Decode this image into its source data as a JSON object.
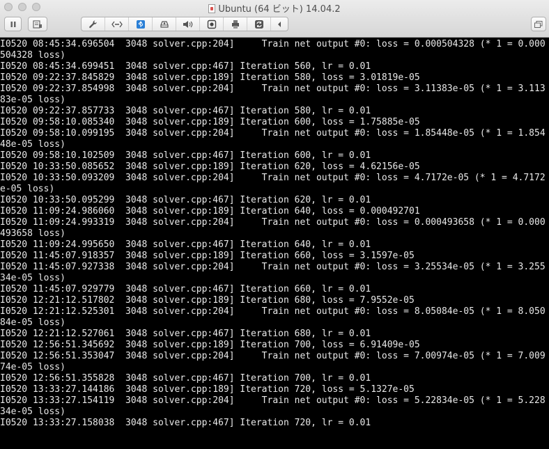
{
  "window": {
    "title": "Ubuntu (64 ビット) 14.04.2"
  },
  "toolbar": {
    "icons": [
      "pause-icon",
      "snapshot-icon",
      "wrench-icon",
      "network-icon",
      "usb-icon",
      "disk-icon",
      "speaker-icon",
      "camera-icon",
      "printer-icon",
      "sync-icon",
      "chevron-left-icon",
      "window-icon"
    ]
  },
  "terminal": {
    "lines": [
      "I0520 08:45:34.696504  3048 solver.cpp:204]     Train net output #0: loss = 0.000504328 (* 1 = 0.000",
      "504328 loss)",
      "I0520 08:45:34.699451  3048 solver.cpp:467] Iteration 560, lr = 0.01",
      "I0520 09:22:37.845829  3048 solver.cpp:189] Iteration 580, loss = 3.01819e-05",
      "I0520 09:22:37.854998  3048 solver.cpp:204]     Train net output #0: loss = 3.11383e-05 (* 1 = 3.113",
      "83e-05 loss)",
      "I0520 09:22:37.857733  3048 solver.cpp:467] Iteration 580, lr = 0.01",
      "I0520 09:58:10.085340  3048 solver.cpp:189] Iteration 600, loss = 1.75885e-05",
      "I0520 09:58:10.099195  3048 solver.cpp:204]     Train net output #0: loss = 1.85448e-05 (* 1 = 1.854",
      "48e-05 loss)",
      "I0520 09:58:10.102509  3048 solver.cpp:467] Iteration 600, lr = 0.01",
      "I0520 10:33:50.085652  3048 solver.cpp:189] Iteration 620, loss = 4.62156e-05",
      "I0520 10:33:50.093209  3048 solver.cpp:204]     Train net output #0: loss = 4.7172e-05 (* 1 = 4.7172",
      "e-05 loss)",
      "I0520 10:33:50.095299  3048 solver.cpp:467] Iteration 620, lr = 0.01",
      "I0520 11:09:24.986060  3048 solver.cpp:189] Iteration 640, loss = 0.000492701",
      "I0520 11:09:24.993319  3048 solver.cpp:204]     Train net output #0: loss = 0.000493658 (* 1 = 0.000",
      "493658 loss)",
      "I0520 11:09:24.995650  3048 solver.cpp:467] Iteration 640, lr = 0.01",
      "I0520 11:45:07.918357  3048 solver.cpp:189] Iteration 660, loss = 3.1597e-05",
      "I0520 11:45:07.927338  3048 solver.cpp:204]     Train net output #0: loss = 3.25534e-05 (* 1 = 3.255",
      "34e-05 loss)",
      "I0520 11:45:07.929779  3048 solver.cpp:467] Iteration 660, lr = 0.01",
      "I0520 12:21:12.517802  3048 solver.cpp:189] Iteration 680, loss = 7.9552e-05",
      "I0520 12:21:12.525301  3048 solver.cpp:204]     Train net output #0: loss = 8.05084e-05 (* 1 = 8.050",
      "84e-05 loss)",
      "I0520 12:21:12.527061  3048 solver.cpp:467] Iteration 680, lr = 0.01",
      "I0520 12:56:51.345692  3048 solver.cpp:189] Iteration 700, loss = 6.91409e-05",
      "I0520 12:56:51.353047  3048 solver.cpp:204]     Train net output #0: loss = 7.00974e-05 (* 1 = 7.009",
      "74e-05 loss)",
      "I0520 12:56:51.355828  3048 solver.cpp:467] Iteration 700, lr = 0.01",
      "I0520 13:33:27.144186  3048 solver.cpp:189] Iteration 720, loss = 5.1327e-05",
      "I0520 13:33:27.154119  3048 solver.cpp:204]     Train net output #0: loss = 5.22834e-05 (* 1 = 5.228",
      "34e-05 loss)",
      "I0520 13:33:27.158038  3048 solver.cpp:467] Iteration 720, lr = 0.01"
    ]
  }
}
